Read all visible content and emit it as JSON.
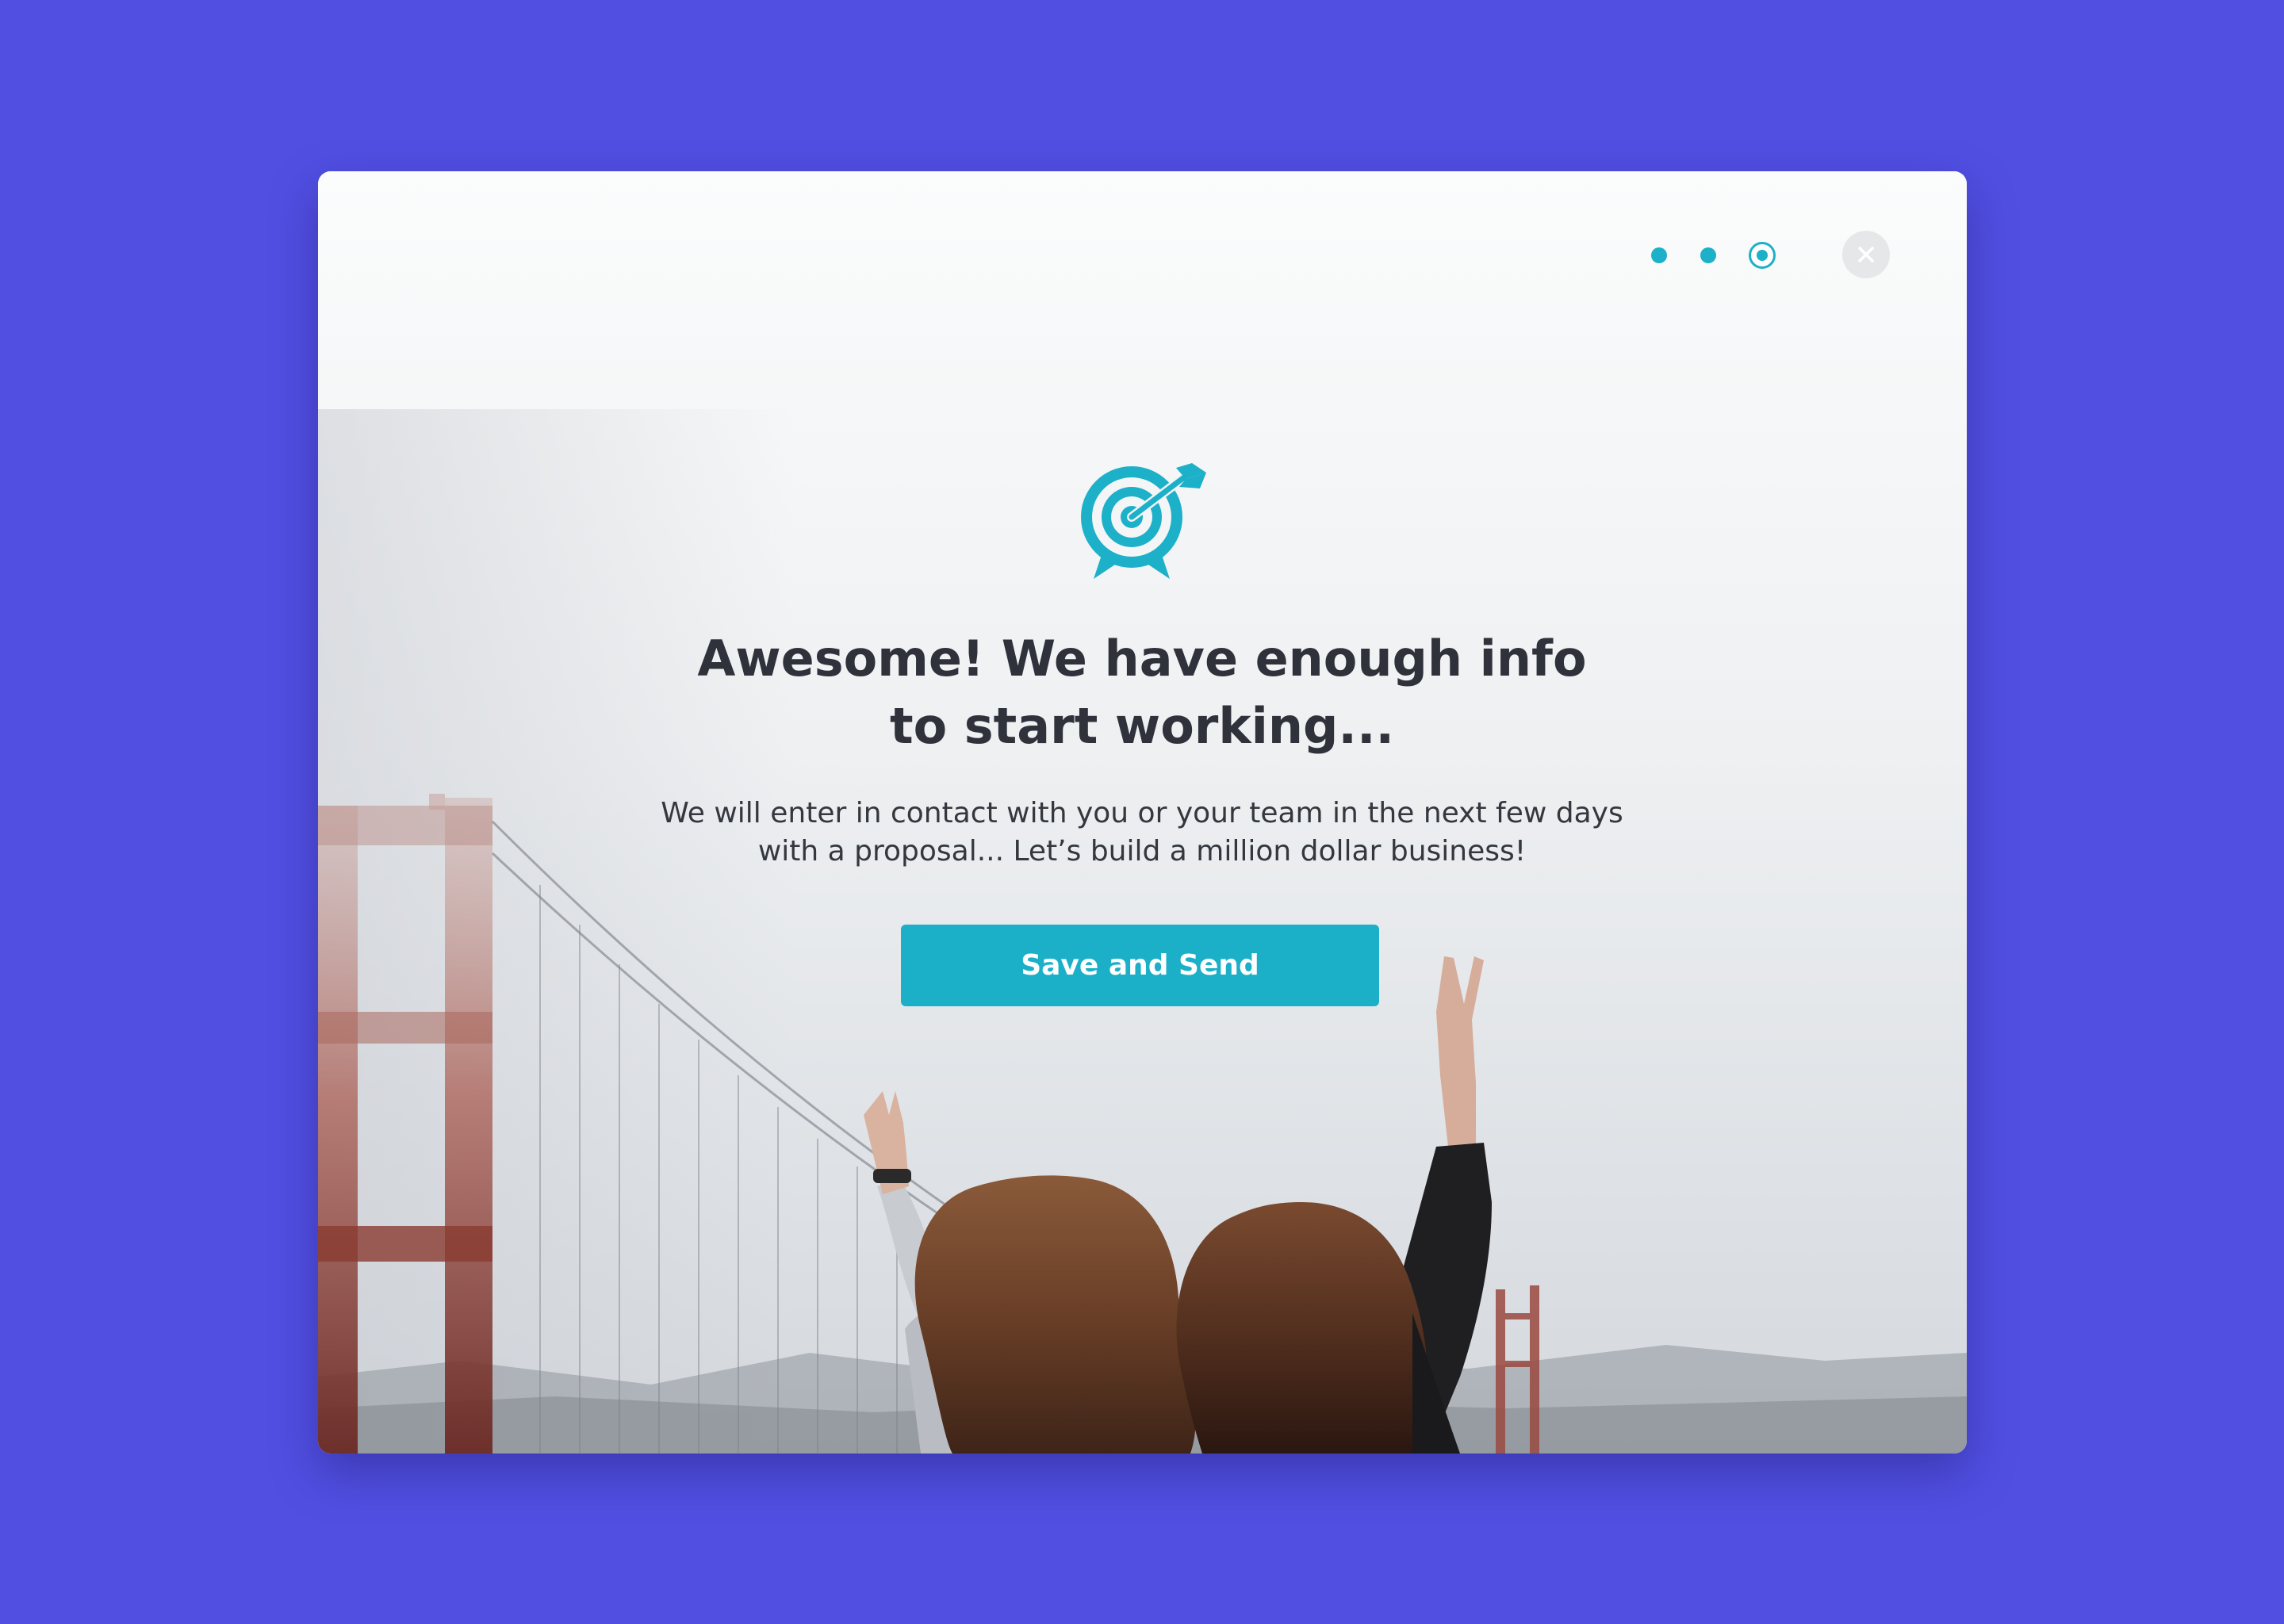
{
  "dialog": {
    "title_line1": "Awesome! We have enough info",
    "title_line2": "to start working...",
    "body_line1": "We will enter in contact with you or your team in the next few days",
    "body_line2": "with a proposal... Let’s build a million dollar business!",
    "cta_label": "Save and Send",
    "icon": "target-icon",
    "close_icon": "close-icon"
  },
  "steps": {
    "total": 3,
    "current": 3
  },
  "colors": {
    "background": "#514fe2",
    "accent": "#1cb0c9",
    "title_text": "#2f323b",
    "body_text": "#34373e",
    "button_text": "#ffffff",
    "bridge": "#9a4a3f"
  }
}
